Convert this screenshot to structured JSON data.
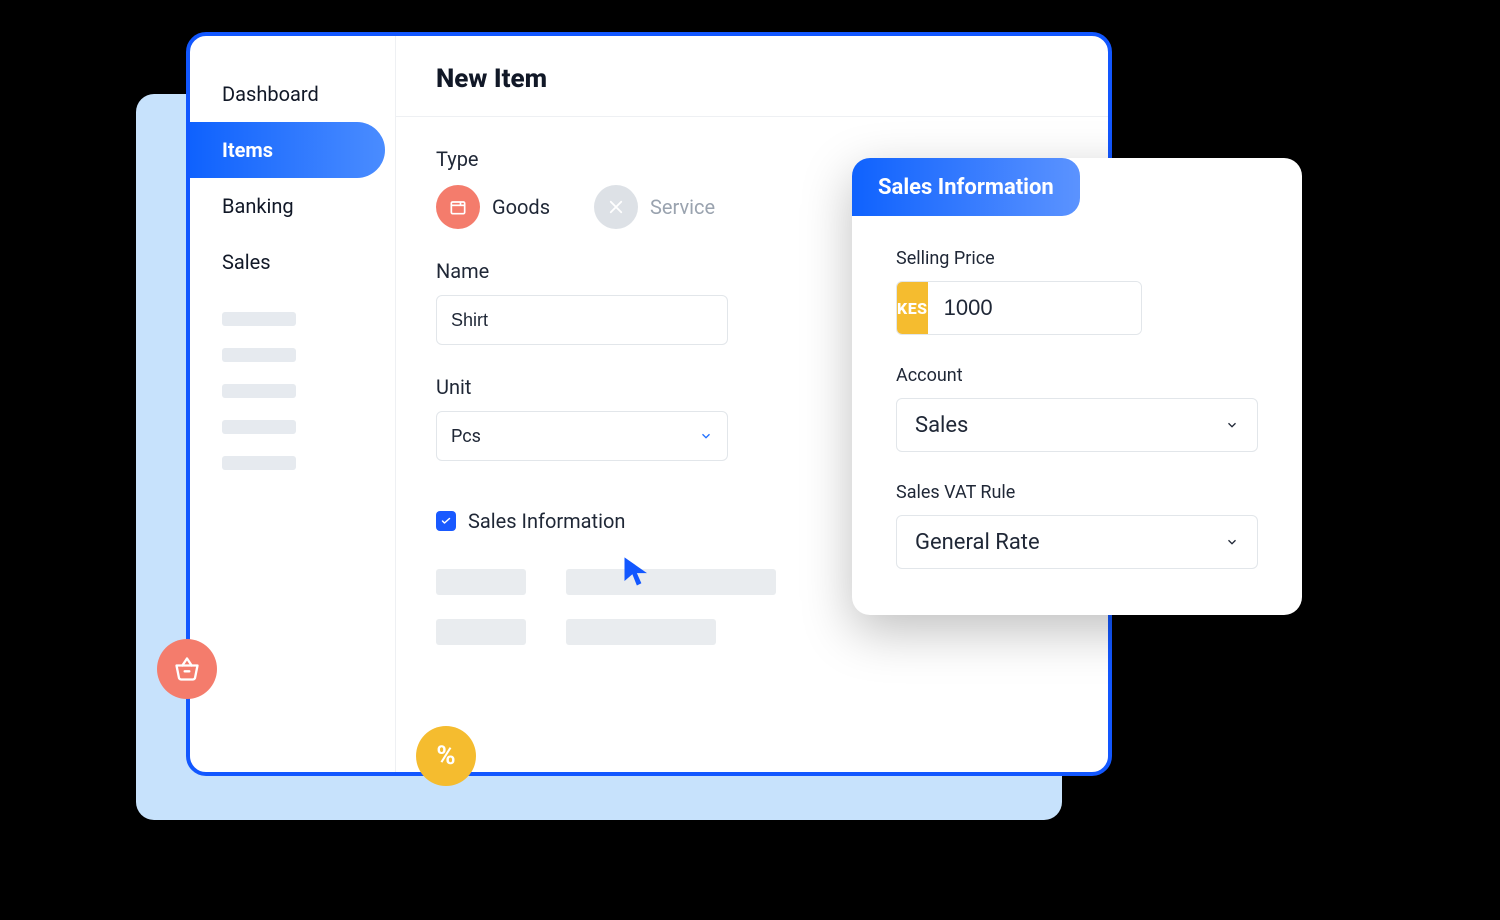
{
  "sidebar": {
    "items": [
      {
        "label": "Dashboard",
        "active": false
      },
      {
        "label": "Items",
        "active": true
      },
      {
        "label": "Banking",
        "active": false
      },
      {
        "label": "Sales",
        "active": false
      }
    ]
  },
  "page": {
    "title": "New Item"
  },
  "form": {
    "type": {
      "label": "Type",
      "options": {
        "goods": "Goods",
        "service": "Service"
      },
      "selected": "goods"
    },
    "name": {
      "label": "Name",
      "value": "Shirt"
    },
    "unit": {
      "label": "Unit",
      "value": "Pcs"
    },
    "sales_info_checkbox": {
      "label": "Sales Information",
      "checked": true
    }
  },
  "sales_card": {
    "title": "Sales Information",
    "selling_price": {
      "label": "Selling Price",
      "currency": "KES",
      "value": "1000"
    },
    "account": {
      "label": "Account",
      "value": "Sales"
    },
    "vat_rule": {
      "label": "Sales VAT Rule",
      "value": "General Rate"
    }
  },
  "badges": {
    "percent": "%"
  }
}
